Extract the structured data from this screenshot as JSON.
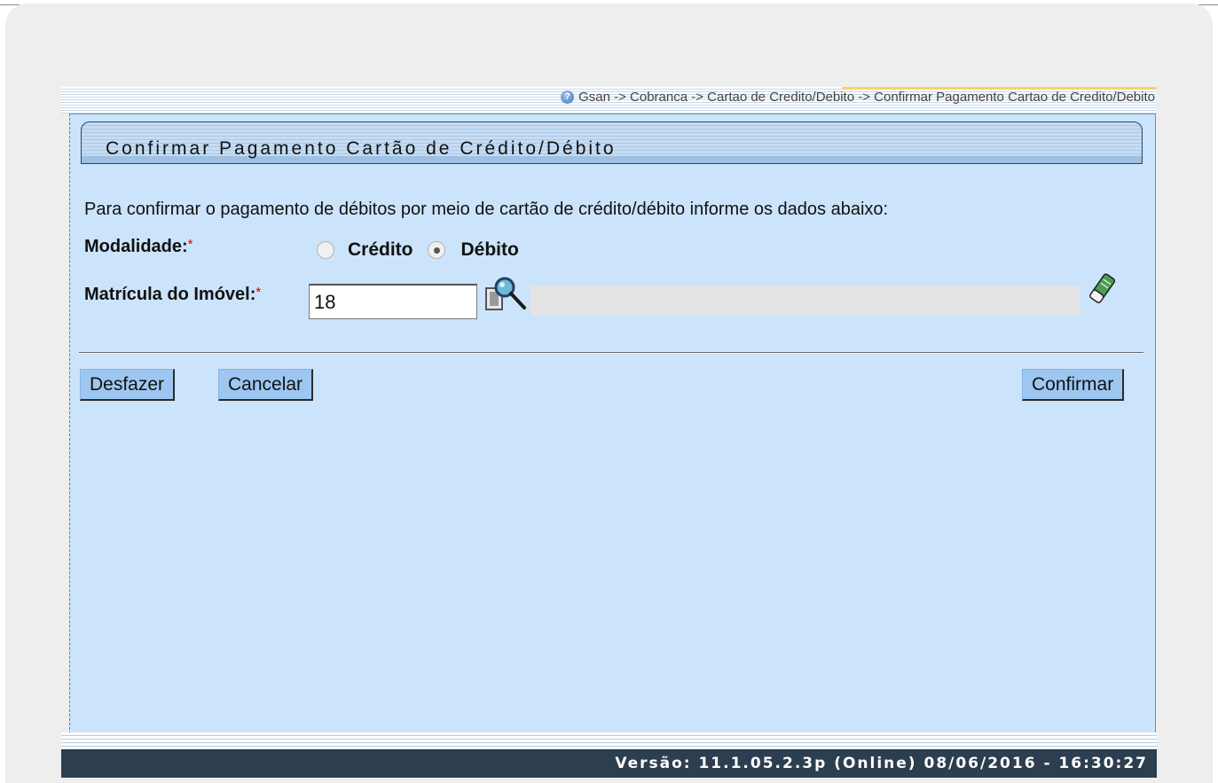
{
  "breadcrumb": "Gsan -> Cobranca -> Cartao de Credito/Debito -> Confirmar Pagamento Cartao de Credito/Debito",
  "form": {
    "title": "Confirmar Pagamento Cartão de Crédito/Débito",
    "intro": "Para confirmar o pagamento de débitos por meio de cartão de crédito/débito informe os dados abaixo:",
    "required_mark": "*",
    "modalidade": {
      "label": "Modalidade:",
      "options": [
        {
          "label": "Crédito",
          "checked": false
        },
        {
          "label": "Débito",
          "checked": true
        }
      ]
    },
    "matricula": {
      "label": "Matrícula do Imóvel:",
      "value": "18",
      "description": ""
    }
  },
  "buttons": {
    "desfazer": "Desfazer",
    "cancelar": "Cancelar",
    "confirmar": "Confirmar"
  },
  "footer": {
    "version": "Versão: 11.1.05.2.3p (Online) 08/06/2016 - 16:30:27"
  },
  "colors": {
    "content_bg": "#cce4fb",
    "button_bg": "#9dc7f1",
    "footer_bg": "#2c3e50",
    "required": "#dd0000"
  },
  "icons": {
    "help": "help-icon",
    "lookup": "magnifier-icon",
    "clear": "eraser-icon"
  }
}
